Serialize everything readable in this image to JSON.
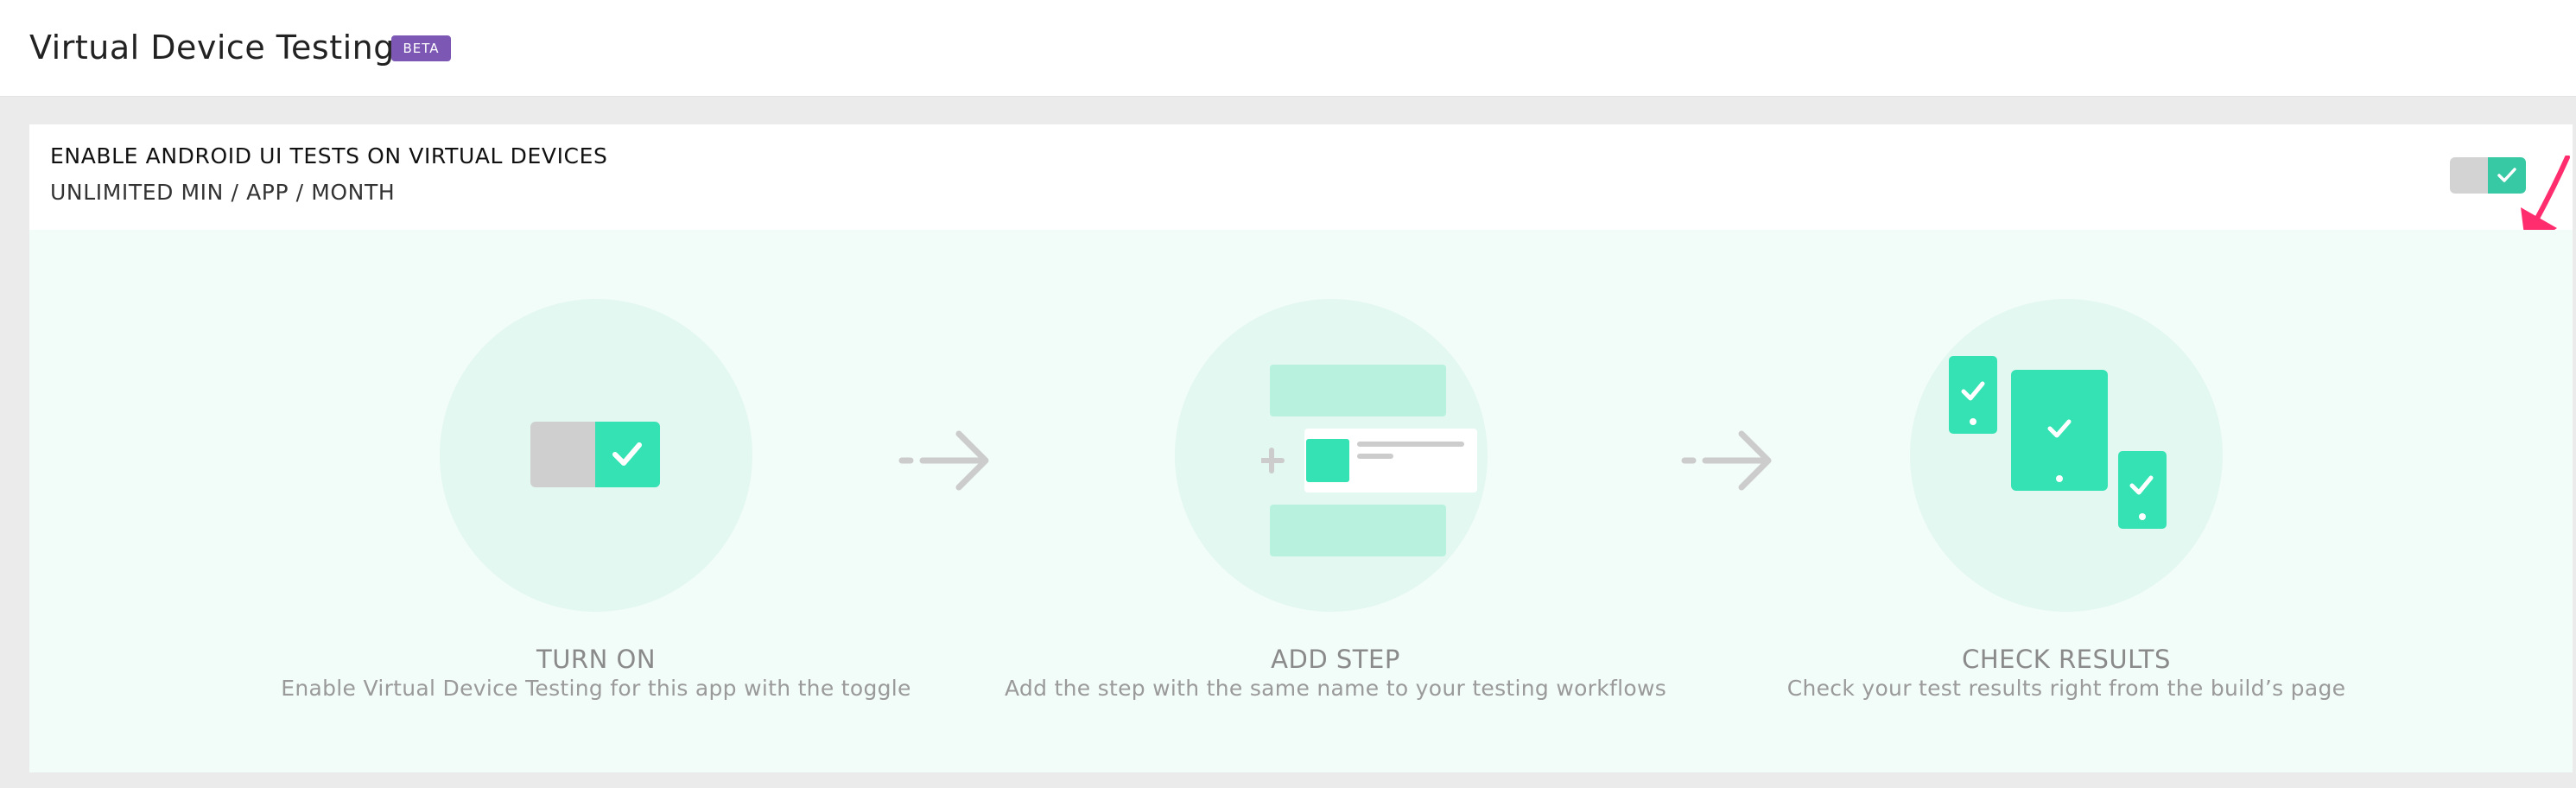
{
  "header": {
    "title": "Virtual Device Testing",
    "badge": "BETA"
  },
  "feature": {
    "title": "ENABLE ANDROID UI TESTS ON VIRTUAL DEVICES",
    "subtitle": "UNLIMITED MIN / APP / MONTH",
    "toggle_on": true
  },
  "steps": [
    {
      "title": "TURN ON",
      "description": "Enable Virtual Device Testing for this app with the toggle",
      "icon": "toggle-illustration-icon"
    },
    {
      "title": "ADD STEP",
      "description": "Add the step with the same name to your testing workflows",
      "icon": "add-step-illustration-icon"
    },
    {
      "title": "CHECK RESULTS",
      "description": "Check your test results right from the build’s page",
      "icon": "devices-illustration-icon"
    }
  ],
  "colors": {
    "accent": "#37c8a4",
    "illustration": "#35e2b4",
    "badge": "#7c57b4",
    "annotation": "#ff2d6e"
  }
}
